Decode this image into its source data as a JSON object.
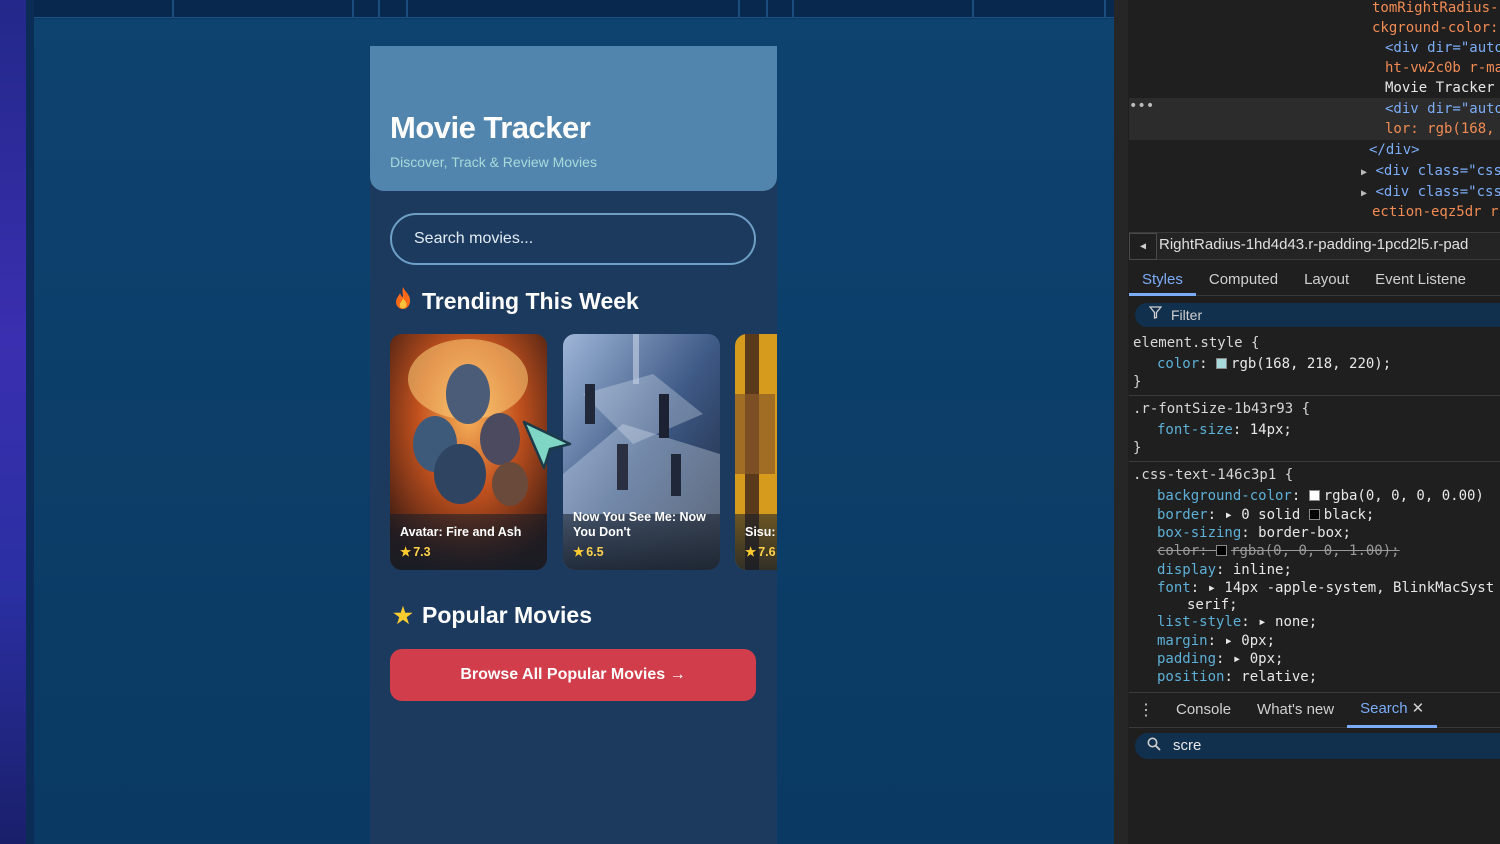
{
  "app": {
    "title": "Movie Tracker",
    "subtitle": "Discover, Track & Review Movies",
    "search_placeholder": "Search movies...",
    "trending": {
      "icon": "fire-icon",
      "title": "Trending This Week",
      "movies": [
        {
          "title": "Avatar: Fire and Ash",
          "rating": "7.3"
        },
        {
          "title": "Now You See Me: Now You Don't",
          "rating": "6.5"
        },
        {
          "title": "Sisu:",
          "rating": "7.6"
        }
      ]
    },
    "popular": {
      "icon": "star-icon",
      "title": "Popular Movies",
      "button_label": "Browse All Popular Movies →"
    },
    "colors": {
      "header_bg": "#5285ad",
      "page_bg": "#1c3a5e",
      "accent_button": "#d13d4b",
      "subtitle": "#a8dadc",
      "rating": "#ffd34a"
    }
  },
  "devtools": {
    "dom_lines": [
      "tomRightRadius-",
      "ckground-color:",
      "<div dir=\"auto",
      "ht-vw2c0b r-ma",
      "Movie Tracker",
      "<div dir=\"auto",
      "lor: rgb(168,",
      "</div>",
      "<div class=\"css",
      "<div class=\"css",
      "ection-eqz5dr r"
    ],
    "breadcrumb": "RightRadius-1hd4d43.r-padding-1pcd2l5.r-pad",
    "tabs": [
      "Styles",
      "Computed",
      "Layout",
      "Event Listene"
    ],
    "filter_placeholder": "Filter",
    "styles": {
      "element_style_selector": "element.style {",
      "element_color_prop": "color",
      "element_color_value": "rgb(168, 218, 220);",
      "rule1_selector": ".r-fontSize-1b43r93 {",
      "rule1_prop": "font-size",
      "rule1_value": "14px;",
      "rule2_selector": ".css-text-146c3p1 {",
      "rule2_props": [
        {
          "name": "background-color",
          "value": "rgba(0, 0, 0, 0.00)",
          "swatch": "#ffffff",
          "struck": false
        },
        {
          "name": "border",
          "value": "▸ 0 solid",
          "extra": "black;",
          "swatch": "#000000",
          "struck": false
        },
        {
          "name": "box-sizing",
          "value": "border-box;",
          "struck": false
        },
        {
          "name": "color",
          "value": "rgba(0, 0, 0, 1.00);",
          "swatch": "#000000",
          "struck": true
        },
        {
          "name": "display",
          "value": "inline;",
          "struck": false
        },
        {
          "name": "font",
          "value": "▸ 14px -apple-system, BlinkMacSyst",
          "struck": false
        },
        {
          "name": "",
          "value": "serif;",
          "struck": false
        },
        {
          "name": "list-style",
          "value": "▸ none;",
          "struck": false
        },
        {
          "name": "margin",
          "value": "▸ 0px;",
          "struck": false
        },
        {
          "name": "padding",
          "value": "▸ 0px;",
          "struck": false
        },
        {
          "name": "position",
          "value": "relative;",
          "struck": false
        }
      ],
      "close_brace": "}"
    },
    "drawer_tabs": [
      "Console",
      "What's new",
      "Search"
    ],
    "search_value": "scre"
  }
}
